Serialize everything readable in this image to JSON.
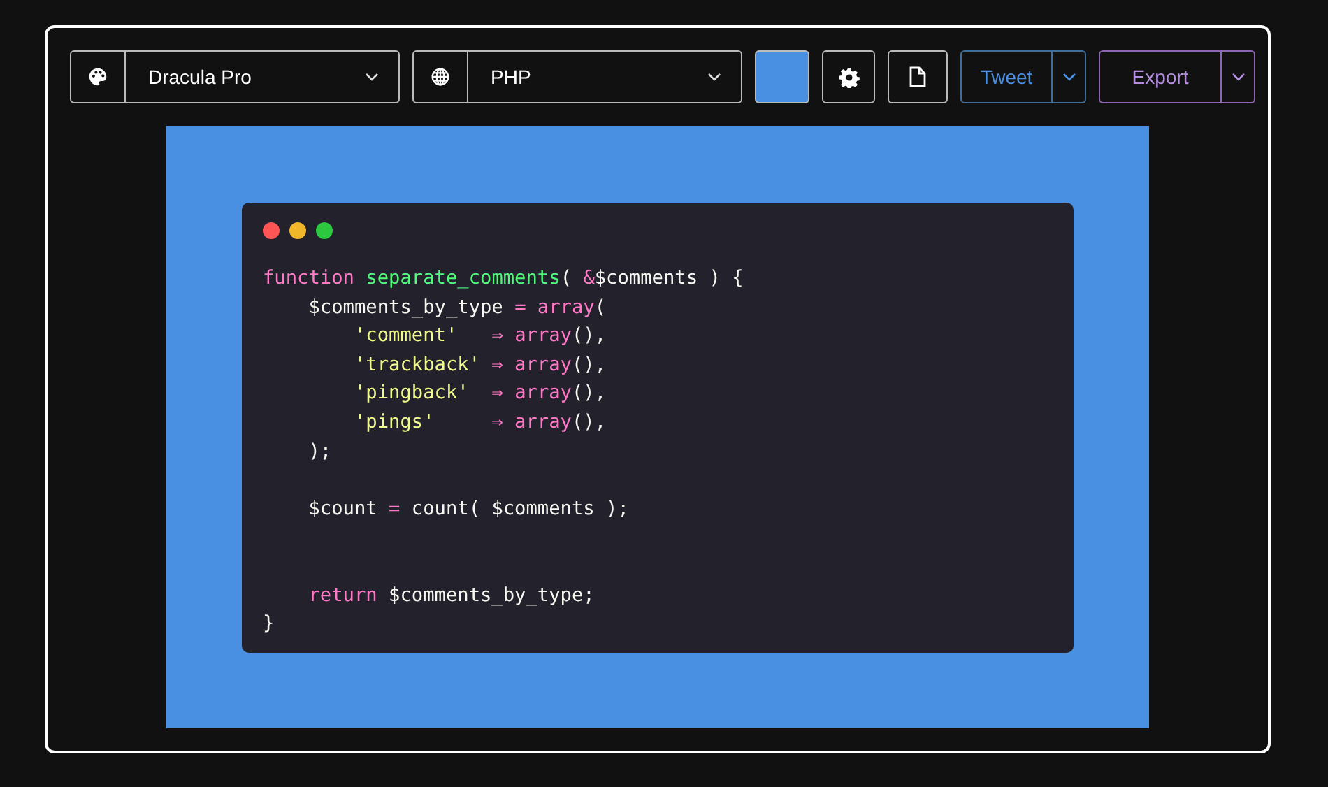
{
  "toolbar": {
    "theme": {
      "value": "Dracula Pro"
    },
    "language": {
      "value": "PHP"
    },
    "tweet": {
      "label": "Tweet"
    },
    "export": {
      "label": "Export"
    }
  },
  "code_window": {
    "lines": [
      {
        "kind": "code",
        "tokens": [
          {
            "kind": "keyword",
            "text": "function"
          },
          {
            "kind": "function",
            "text": " separate_comments"
          },
          {
            "kind": "plain",
            "text": "( "
          },
          {
            "kind": "operator",
            "text": "&"
          },
          {
            "kind": "plain",
            "text": "$comments ) {"
          }
        ]
      },
      {
        "kind": "code",
        "tokens": [
          {
            "kind": "plain",
            "text": "    $comments_by_type "
          },
          {
            "kind": "operator",
            "text": "="
          },
          {
            "kind": "keyword",
            "text": " array"
          },
          {
            "kind": "plain",
            "text": "("
          }
        ]
      },
      {
        "kind": "code",
        "tokens": [
          {
            "kind": "string",
            "text": "        'comment'"
          },
          {
            "kind": "operator",
            "text": "   ⇒"
          },
          {
            "kind": "keyword",
            "text": " array"
          },
          {
            "kind": "plain",
            "text": "(),"
          }
        ]
      },
      {
        "kind": "code",
        "tokens": [
          {
            "kind": "string",
            "text": "        'trackback'"
          },
          {
            "kind": "operator",
            "text": " ⇒"
          },
          {
            "kind": "keyword",
            "text": " array"
          },
          {
            "kind": "plain",
            "text": "(),"
          }
        ]
      },
      {
        "kind": "code",
        "tokens": [
          {
            "kind": "string",
            "text": "        'pingback'"
          },
          {
            "kind": "operator",
            "text": "  ⇒"
          },
          {
            "kind": "keyword",
            "text": " array"
          },
          {
            "kind": "plain",
            "text": "(),"
          }
        ]
      },
      {
        "kind": "code",
        "tokens": [
          {
            "kind": "string",
            "text": "        'pings'"
          },
          {
            "kind": "operator",
            "text": "     ⇒"
          },
          {
            "kind": "keyword",
            "text": " array"
          },
          {
            "kind": "plain",
            "text": "(),"
          }
        ]
      },
      {
        "kind": "code",
        "tokens": [
          {
            "kind": "plain",
            "text": "    );"
          }
        ]
      },
      {
        "kind": "blank"
      },
      {
        "kind": "code",
        "tokens": [
          {
            "kind": "plain",
            "text": "    $count "
          },
          {
            "kind": "operator",
            "text": "="
          },
          {
            "kind": "plain",
            "text": " count( $comments );"
          }
        ]
      },
      {
        "kind": "blank"
      },
      {
        "kind": "blank"
      },
      {
        "kind": "code",
        "tokens": [
          {
            "kind": "keyword",
            "text": "    return"
          },
          {
            "kind": "plain",
            "text": " $comments_by_type;"
          }
        ]
      },
      {
        "kind": "code",
        "tokens": [
          {
            "kind": "plain",
            "text": "}"
          }
        ]
      }
    ]
  }
}
